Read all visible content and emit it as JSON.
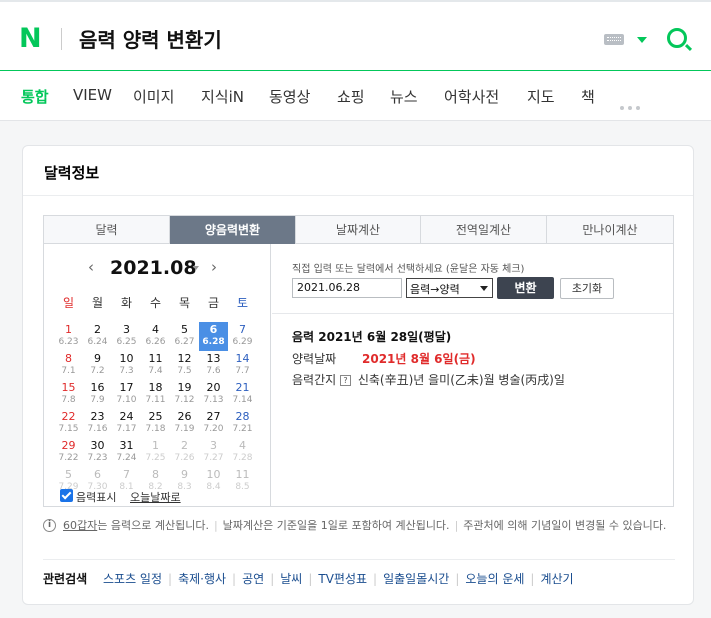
{
  "header": {
    "logo": "N",
    "query": "음력 양력 변환기"
  },
  "tabs": [
    "통합",
    "VIEW",
    "이미지",
    "지식iN",
    "동영상",
    "쇼핑",
    "뉴스",
    "어학사전",
    "지도",
    "책"
  ],
  "card": {
    "title": "달력정보",
    "widget_tabs": [
      "달력",
      "양음력변환",
      "날짜계산",
      "전역일계산",
      "만나이계산"
    ],
    "calendar": {
      "month_label": "2021.08",
      "weekdays": [
        "일",
        "월",
        "화",
        "수",
        "목",
        "금",
        "토"
      ],
      "weeks": [
        [
          [
            "1",
            "6.23"
          ],
          [
            "2",
            "6.24"
          ],
          [
            "3",
            "6.25"
          ],
          [
            "4",
            "6.26"
          ],
          [
            "5",
            "6.27"
          ],
          [
            "6",
            "6.28"
          ],
          [
            "7",
            "6.29"
          ]
        ],
        [
          [
            "8",
            "7.1"
          ],
          [
            "9",
            "7.2"
          ],
          [
            "10",
            "7.3"
          ],
          [
            "11",
            "7.4"
          ],
          [
            "12",
            "7.5"
          ],
          [
            "13",
            "7.6"
          ],
          [
            "14",
            "7.7"
          ]
        ],
        [
          [
            "15",
            "7.8"
          ],
          [
            "16",
            "7.9"
          ],
          [
            "17",
            "7.10"
          ],
          [
            "18",
            "7.11"
          ],
          [
            "19",
            "7.12"
          ],
          [
            "20",
            "7.13"
          ],
          [
            "21",
            "7.14"
          ]
        ],
        [
          [
            "22",
            "7.15"
          ],
          [
            "23",
            "7.16"
          ],
          [
            "24",
            "7.17"
          ],
          [
            "25",
            "7.18"
          ],
          [
            "26",
            "7.19"
          ],
          [
            "27",
            "7.20"
          ],
          [
            "28",
            "7.21"
          ]
        ],
        [
          [
            "29",
            "7.22"
          ],
          [
            "30",
            "7.23"
          ],
          [
            "31",
            "7.24"
          ],
          [
            "1",
            "7.25"
          ],
          [
            "2",
            "7.26"
          ],
          [
            "3",
            "7.27"
          ],
          [
            "4",
            "7.28"
          ]
        ],
        [
          [
            "5",
            "7.29"
          ],
          [
            "6",
            "7.30"
          ],
          [
            "7",
            "8.1"
          ],
          [
            "8",
            "8.2"
          ],
          [
            "9",
            "8.3"
          ],
          [
            "10",
            "8.4"
          ],
          [
            "11",
            "8.5"
          ]
        ]
      ],
      "selected_day": "6",
      "lunar_checkbox_label": "음력표시",
      "today_link": "오늘날짜로"
    },
    "converter": {
      "hint": "직접 입력 또는 달력에서 선택하세요 (윤달은 자동 체크)",
      "date_value": "2021.06.28",
      "mode_selected": "음력→양력",
      "convert_label": "변환",
      "reset_label": "초기화",
      "result_title": "음력 2021년 6월 28일(평달)",
      "solar_label": "양력날짜",
      "solar_value": "2021년 8월 6일(금)",
      "ganji_label": "음력간지",
      "ganji_help": "?",
      "ganji_value": "신축(辛丑)년 을미(乙未)월 병술(丙戌)일"
    },
    "notice": {
      "icon": "i",
      "part1_link": "60갑자",
      "part1_rest": "는 음력으로 계산됩니다.",
      "part2": "날짜계산은 기준일을 1일로 포함하여 계산됩니다.",
      "part3": "주관처에 의해 기념일이 변경될 수 있습니다."
    },
    "related": {
      "label": "관련검색",
      "items": [
        "스포츠 일정",
        "축제·행사",
        "공연",
        "날씨",
        "TV편성표",
        "일출일몰시간",
        "오늘의 운세",
        "계산기"
      ]
    }
  }
}
